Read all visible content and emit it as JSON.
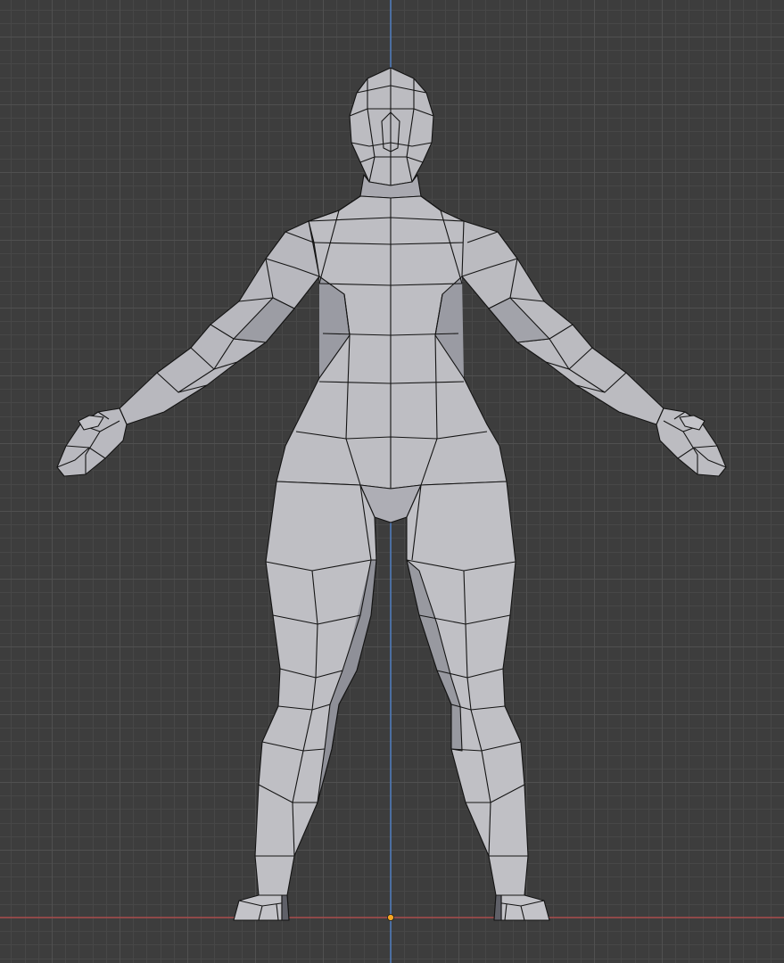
{
  "viewport": {
    "view": "front-orthographic",
    "background_color": "#3d3d3d",
    "grid_minor_color": "#474747",
    "grid_major_color": "#505050",
    "z_axis_color": "#4f7dbf",
    "x_axis_color": "#a84a4a",
    "origin_color": "#f5a623"
  },
  "object": {
    "type": "low-poly humanoid mesh",
    "pose": "A-pose",
    "shading": "solid",
    "surface_color": "#b9b9be",
    "shadow_color": "#8d8e96",
    "wire_color": "#141414"
  }
}
